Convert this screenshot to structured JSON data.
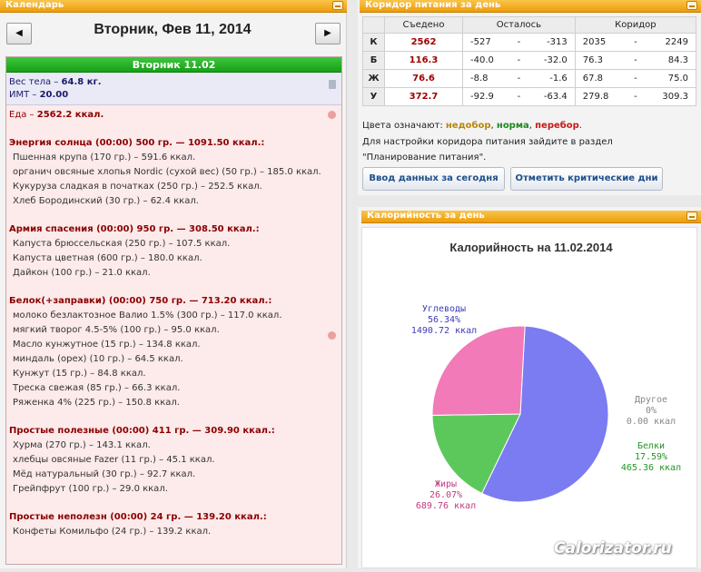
{
  "calendar": {
    "header": "Календарь",
    "prev_glyph": "◀",
    "next_glyph": "▶",
    "date_title": "Вторник, Фев 11, 2014",
    "day_label": "Вторник 11.02",
    "weight_label": "Вес тела",
    "weight_value": "64.8 кг.",
    "bmi_label": "ИМТ",
    "bmi_value": "20.00",
    "food_label": "Еда",
    "food_total": "2562.2 ккал.",
    "meals": [
      {
        "title": "Энергия солнца (00:00) 500 гр. — 1091.50 ккал.:",
        "items": [
          "Пшенная крупа (170 гр.) – 591.6 ккал.",
          "органич овсяные хлопья Nordic (сухой вес) (50 гр.) – 185.0 ккал.",
          "Кукуруза сладкая в початках (250 гр.) – 252.5 ккал.",
          "Хлеб Бородинский (30 гр.) – 62.4 ккал."
        ]
      },
      {
        "title": "Армия спасения (00:00) 950 гр. — 308.50 ккал.:",
        "items": [
          "Капуста брюссельская (250 гр.) – 107.5 ккал.",
          "Капуста цветная (600 гр.) – 180.0 ккал.",
          "Дайкон (100 гр.) – 21.0 ккал."
        ]
      },
      {
        "title": "Белок(+заправки) (00:00) 750 гр. — 713.20 ккал.:",
        "items": [
          "молоко безлактозное Валио 1.5% (300 гр.) – 117.0 ккал.",
          "мягкий творог 4.5-5% (100 гр.) – 95.0 ккал.",
          "Масло кунжутное (15 гр.) – 134.8 ккал.",
          "миндаль (орех) (10 гр.) – 64.5 ккал.",
          "Кунжут (15 гр.) – 84.8 ккал.",
          "Треска свежая (85 гр.) – 66.3 ккал.",
          "Ряженка 4% (225 гр.) – 150.8 ккал."
        ]
      },
      {
        "title": "Простые полезные (00:00) 411 гр. — 309.90 ккал.:",
        "items": [
          "Хурма (270 гр.) – 143.1 ккал.",
          "хлебцы овсяные Fazer (11 гр.) – 45.1 ккал.",
          "Мёд натуральный (30 гр.) – 92.7 ккал.",
          "Грейпфрут (100 гр.) – 29.0 ккал."
        ]
      },
      {
        "title": "Простые неполезн (00:00) 24 гр. — 139.20 ккал.:",
        "items": [
          "Конфеты Комильфо (24 гр.) – 139.2 ккал."
        ]
      }
    ]
  },
  "corridor": {
    "header": "Коридор питания за день",
    "col_eaten": "Съедено",
    "col_left": "Осталось",
    "col_corridor": "Коридор",
    "dash": "-",
    "rows": [
      {
        "label": "К",
        "eaten": "2562",
        "left_min": "-527",
        "left_max": "-313",
        "cor_min": "2035",
        "cor_max": "2249"
      },
      {
        "label": "Б",
        "eaten": "116.3",
        "left_min": "-40.0",
        "left_max": "-32.0",
        "cor_min": "76.3",
        "cor_max": "84.3"
      },
      {
        "label": "Ж",
        "eaten": "76.6",
        "left_min": "-8.8",
        "left_max": "-1.6",
        "cor_min": "67.8",
        "cor_max": "75.0"
      },
      {
        "label": "У",
        "eaten": "372.7",
        "left_min": "-92.9",
        "left_max": "-63.4",
        "cor_min": "279.8",
        "cor_max": "309.3"
      }
    ],
    "legend_prefix": "Цвета означают:",
    "legend_under": "недобор",
    "legend_norm": "норма",
    "legend_over": "перебор",
    "note_line1": "Для настройки коридора питания зайдите в раздел",
    "note_line2": "\"Планирование питания\".",
    "btn_enter": "Ввод данных за сегодня",
    "btn_critical": "Отметить критические дни"
  },
  "calories": {
    "header": "Калорийность за день"
  },
  "chart_data": {
    "type": "pie",
    "title": "Калорийность на 11.02.2014",
    "slices": [
      {
        "name": "Углеводы",
        "percent_label": "56.34%",
        "kcal_label": "1490.72 ккал",
        "value": 56.34,
        "color": "#7b7bf2"
      },
      {
        "name": "Другое",
        "percent_label": "0%",
        "kcal_label": "0.00 ккал",
        "value": 0,
        "color": "#cccccc"
      },
      {
        "name": "Белки",
        "percent_label": "17.59%",
        "kcal_label": "465.36 ккал",
        "value": 17.59,
        "color": "#5cc85c"
      },
      {
        "name": "Жиры",
        "percent_label": "26.07%",
        "kcal_label": "689.76 ккал",
        "value": 26.07,
        "color": "#f27ab8"
      }
    ],
    "label_colors": {
      "Углеводы": "#3b3bbb",
      "Другое": "#888888",
      "Белки": "#239623",
      "Жиры": "#c03a80"
    }
  },
  "watermark": "Calorizator.ru"
}
